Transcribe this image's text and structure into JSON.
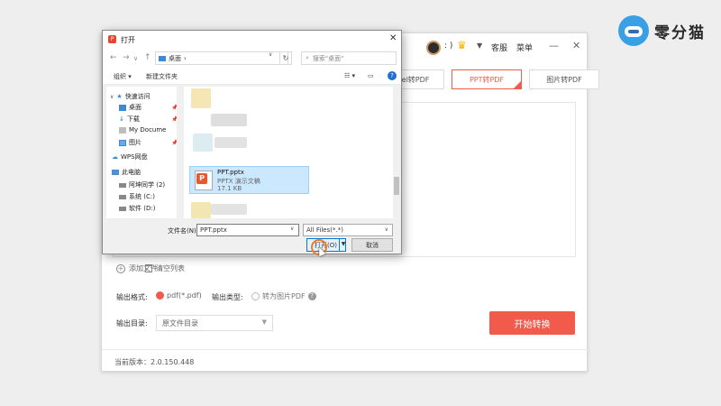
{
  "brand": {
    "name": "零分猫"
  },
  "app": {
    "header": {
      "user_text": ": )",
      "service": "客服",
      "menu": "菜单",
      "minimize": "—",
      "close": "✕"
    },
    "tabs": [
      {
        "label": "Excel转PDF",
        "active": false
      },
      {
        "label": "PPT转PDF",
        "active": true
      },
      {
        "label": "图片转PDF",
        "active": false
      }
    ],
    "actions": {
      "add_file": "添加文件",
      "clear_list": "清空列表"
    },
    "output": {
      "format_label": "输出格式:",
      "format_value": "pdf(*.pdf)",
      "type_label": "输出类型:",
      "type_value": "转为图片PDF",
      "dir_label": "输出目录:",
      "dir_value": "原文件目录"
    },
    "start_button": "开始转换",
    "version": "当前版本：2.0.150.448"
  },
  "dialog": {
    "title": "打开",
    "close": "✕",
    "address": "桌面",
    "address_sep": "›",
    "search_placeholder": "搜索\"桌面\"",
    "toolbar": {
      "organize": "组织 ▾",
      "new_folder": "新建文件夹"
    },
    "nav_items": [
      {
        "label": "快速访问",
        "icon": "star-icon",
        "color": "#3c8ad6"
      },
      {
        "label": "桌面",
        "icon": "desktop-icon",
        "color": "#3c8ad6",
        "pinned": true
      },
      {
        "label": "下载",
        "icon": "download-icon",
        "color": "#3c8ad6",
        "pinned": true
      },
      {
        "label": "My Docume",
        "icon": "document-icon",
        "color": "#8a8a8a",
        "pinned": true
      },
      {
        "label": "图片",
        "icon": "picture-icon",
        "color": "#3c8ad6",
        "pinned": true
      },
      {
        "label": "WPS网盘",
        "icon": "cloud-icon",
        "color": "#3c8ad6"
      },
      {
        "label": "此电脑",
        "icon": "computer-icon",
        "color": "#3c8ad6"
      },
      {
        "label": "阿坤同学 (2)",
        "icon": "drive-icon",
        "color": "#666666"
      },
      {
        "label": "系统 (C:)",
        "icon": "drive-icon",
        "color": "#666666"
      },
      {
        "label": "软件 (D:)",
        "icon": "drive-icon",
        "color": "#666666"
      }
    ],
    "selected_file": {
      "name": "PPT.pptx",
      "type": "PPTX 演示文稿",
      "size": "17.1 KB"
    },
    "filename_label": "文件名(N):",
    "filename_value": "PPT.pptx",
    "filetype_value": "All Files(*.*)",
    "open_button": "打开(O)",
    "cancel_button": "取消"
  }
}
